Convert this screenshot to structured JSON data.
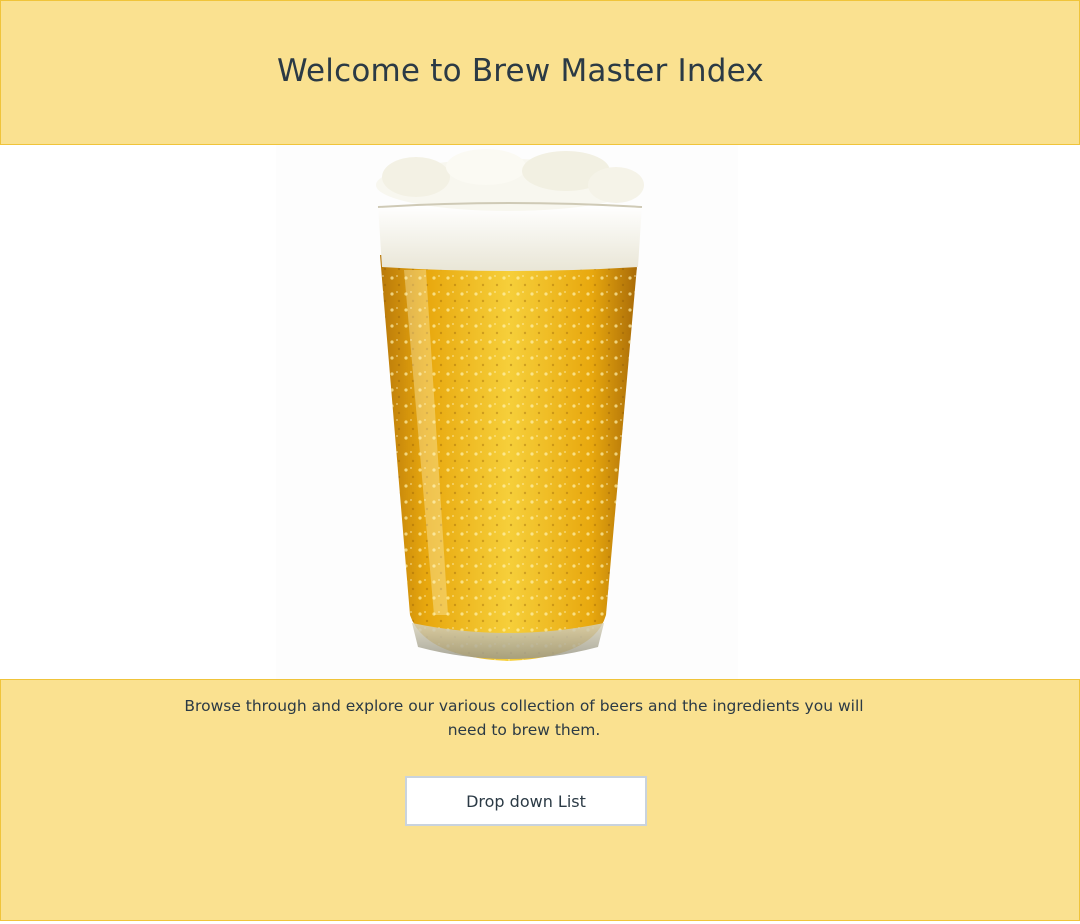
{
  "header": {
    "title": "Welcome to Brew Master Index"
  },
  "hero": {
    "image_name": "beer-glass-image"
  },
  "footer": {
    "description": "Browse through and explore our various collection of beers and the ingredients you will need to brew them.",
    "dropdown_label": "Drop down List"
  },
  "colors": {
    "banner_background": "#fae190",
    "banner_border": "#f0c43a",
    "text": "#2b3a45",
    "beer": "#e8a80e",
    "foam": "#f6f4ea"
  }
}
